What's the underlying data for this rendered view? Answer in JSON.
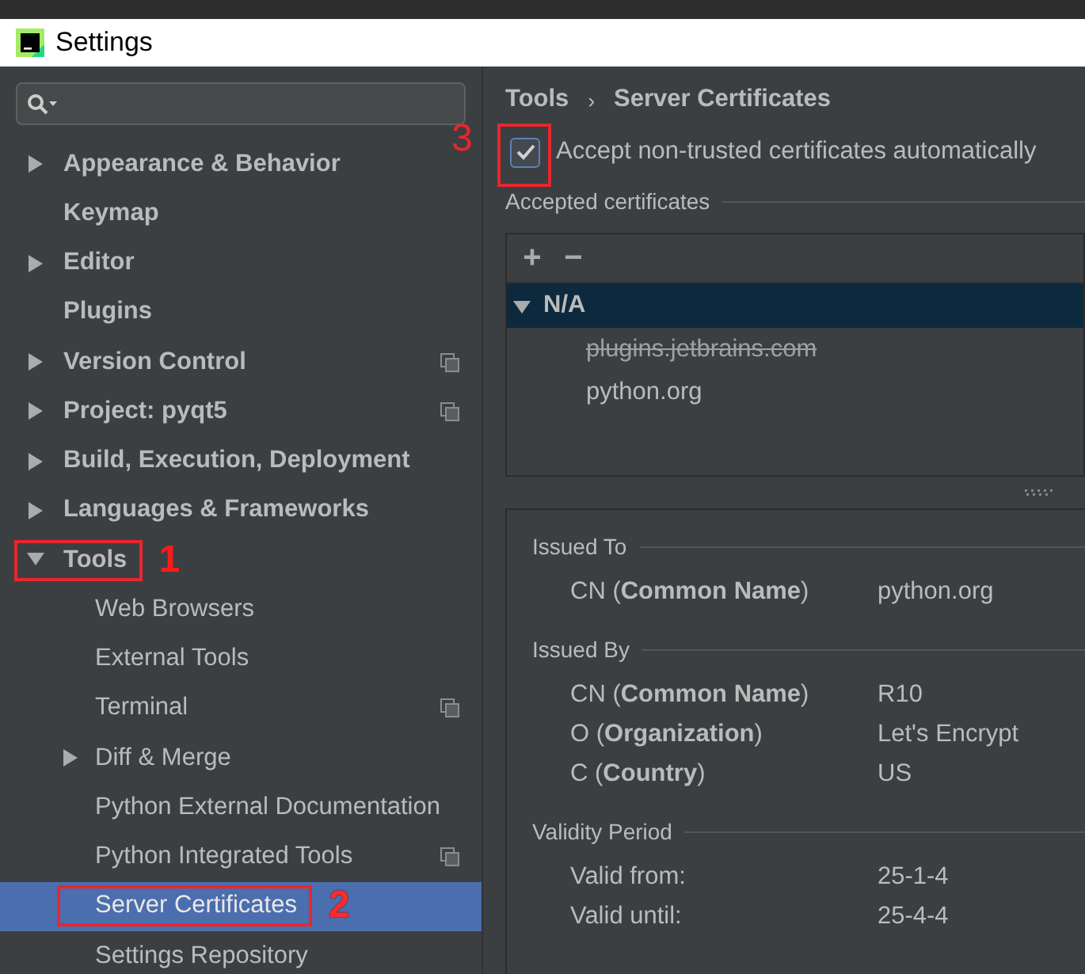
{
  "window": {
    "title": "Settings"
  },
  "sidebar": {
    "items": [
      {
        "label": "Appearance & Behavior",
        "expandable": true,
        "expanded": false,
        "selected": false,
        "project_level": false
      },
      {
        "label": "Keymap",
        "expandable": false,
        "expanded": false,
        "selected": false,
        "project_level": false
      },
      {
        "label": "Editor",
        "expandable": true,
        "expanded": false,
        "selected": false,
        "project_level": false
      },
      {
        "label": "Plugins",
        "expandable": false,
        "expanded": false,
        "selected": false,
        "project_level": false
      },
      {
        "label": "Version Control",
        "expandable": true,
        "expanded": false,
        "selected": false,
        "project_level": true
      },
      {
        "label": "Project: pyqt5",
        "expandable": true,
        "expanded": false,
        "selected": false,
        "project_level": true
      },
      {
        "label": "Build, Execution, Deployment",
        "expandable": true,
        "expanded": false,
        "selected": false,
        "project_level": false
      },
      {
        "label": "Languages & Frameworks",
        "expandable": true,
        "expanded": false,
        "selected": false,
        "project_level": false
      },
      {
        "label": "Tools",
        "expandable": true,
        "expanded": true,
        "selected": false,
        "project_level": false,
        "annotation": "1",
        "children": [
          {
            "label": "Web Browsers",
            "expandable": false,
            "expanded": false,
            "selected": false,
            "project_level": false
          },
          {
            "label": "External Tools",
            "expandable": false,
            "expanded": false,
            "selected": false,
            "project_level": false
          },
          {
            "label": "Terminal",
            "expandable": false,
            "expanded": false,
            "selected": false,
            "project_level": true
          },
          {
            "label": "Diff & Merge",
            "expandable": true,
            "expanded": false,
            "selected": false,
            "project_level": false
          },
          {
            "label": "Python External Documentation",
            "expandable": false,
            "expanded": false,
            "selected": false,
            "project_level": false
          },
          {
            "label": "Python Integrated Tools",
            "expandable": false,
            "expanded": false,
            "selected": false,
            "project_level": true
          },
          {
            "label": "Server Certificates",
            "expandable": false,
            "expanded": false,
            "selected": true,
            "project_level": false,
            "annotation": "2"
          },
          {
            "label": "Settings Repository",
            "expandable": false,
            "expanded": false,
            "selected": false,
            "project_level": false
          }
        ]
      }
    ]
  },
  "content": {
    "breadcrumb": [
      "Tools",
      "Server Certificates"
    ],
    "breadcrumb_separator": "›",
    "accept_checkbox": {
      "label": "Accept non-trusted certificates automatically",
      "checked": true,
      "annotation": "3"
    },
    "accepted_certificates": {
      "title": "Accepted certificates",
      "toolbar": [
        "+",
        "−"
      ],
      "tree": [
        {
          "label": "N/A",
          "expanded": true,
          "selected": true,
          "children": [
            {
              "label": "plugins.jetbrains.com",
              "revoked": true
            },
            {
              "label": "python.org",
              "revoked": false
            }
          ]
        }
      ]
    },
    "details": [
      {
        "title": "Issued To",
        "rows": [
          {
            "field": "CN (**Common Name**)",
            "value": "python.org"
          }
        ]
      },
      {
        "title": "Issued By",
        "rows": [
          {
            "field": "CN (**Common Name**)",
            "value": "R10"
          },
          {
            "field": "O (**Organization**)",
            "value": "Let's Encrypt"
          },
          {
            "field": "C (**Country**)",
            "value": "US"
          }
        ]
      },
      {
        "title": "Validity Period",
        "rows": [
          {
            "field": "Valid from:",
            "value": "25-1-4"
          },
          {
            "field": "Valid until:",
            "value": "25-4-4"
          }
        ]
      }
    ]
  }
}
